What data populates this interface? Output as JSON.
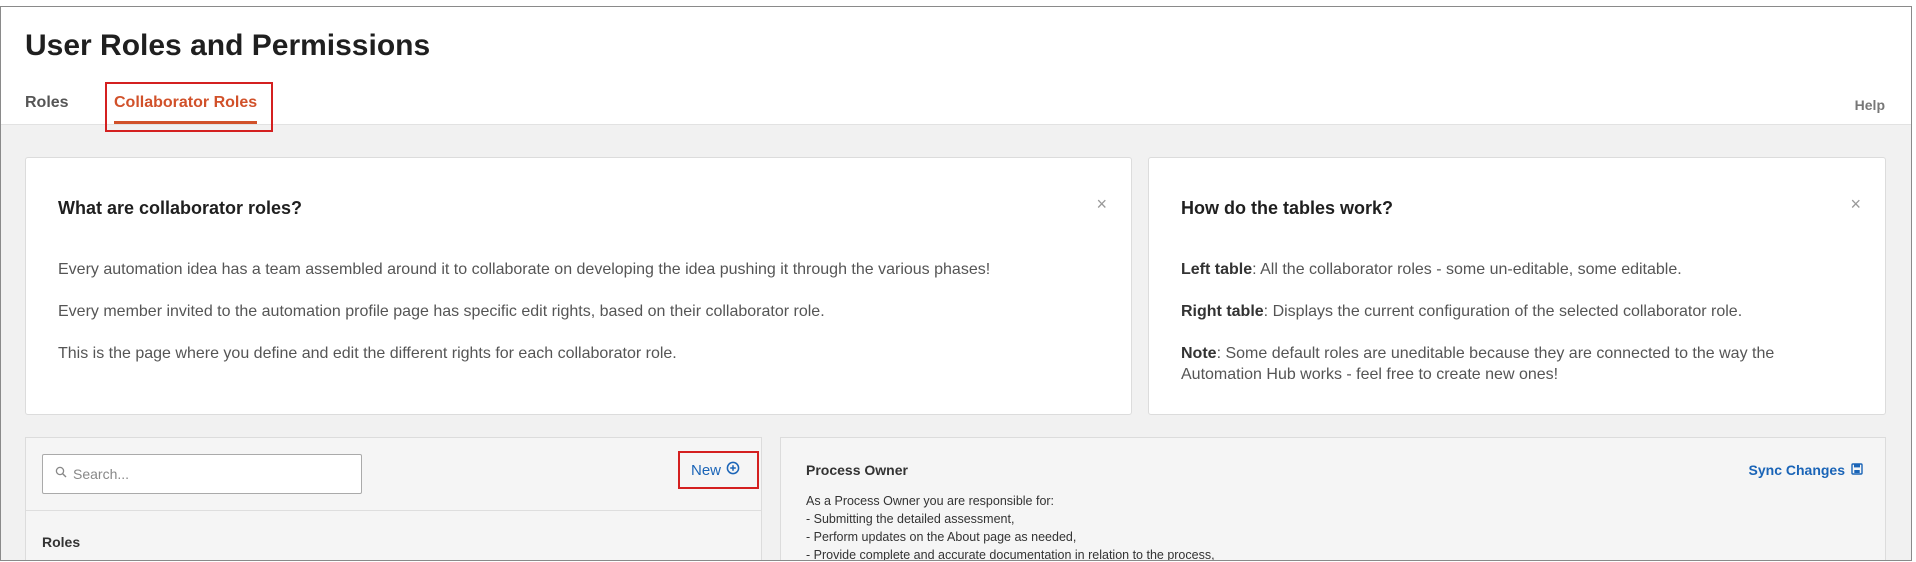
{
  "header": {
    "title": "User Roles and Permissions",
    "tabs": [
      {
        "label": "Roles",
        "active": false
      },
      {
        "label": "Collaborator Roles",
        "active": true
      }
    ],
    "help_label": "Help"
  },
  "info_cards": {
    "left": {
      "title": "What are collaborator roles?",
      "paragraphs": [
        "Every automation idea has a team assembled around it to collaborate on developing the idea pushing it through the various phases!",
        "Every member invited to the automation profile page has specific edit rights, based on their collaborator role.",
        "This is the page where you define and edit the different rights for each collaborator role."
      ],
      "close": "×"
    },
    "right": {
      "title": "How do the tables work?",
      "items": [
        {
          "term": "Left table",
          "text": ": All the collaborator roles - some un-editable, some editable."
        },
        {
          "term": "Right table",
          "text": ": Displays the current configuration of the selected collaborator role."
        },
        {
          "term": "Note",
          "text": ": Some default roles are uneditable because they are connected to the way the Automation Hub works - feel free to create new ones!"
        }
      ],
      "close": "×"
    }
  },
  "roles_table": {
    "search_placeholder": "Search...",
    "new_label": "New",
    "column_header": "Roles"
  },
  "role_detail": {
    "role_name": "Process Owner",
    "sync_label": "Sync Changes",
    "description_lines": [
      "As a Process Owner you are responsible for:",
      "- Submitting the detailed assessment,",
      "- Perform updates on the About page as needed,",
      "- Provide complete and accurate documentation in relation to the process,"
    ]
  },
  "colors": {
    "accent_orange": "#d1512a",
    "link_blue": "#1a64b7",
    "highlight_red": "#d42020"
  }
}
